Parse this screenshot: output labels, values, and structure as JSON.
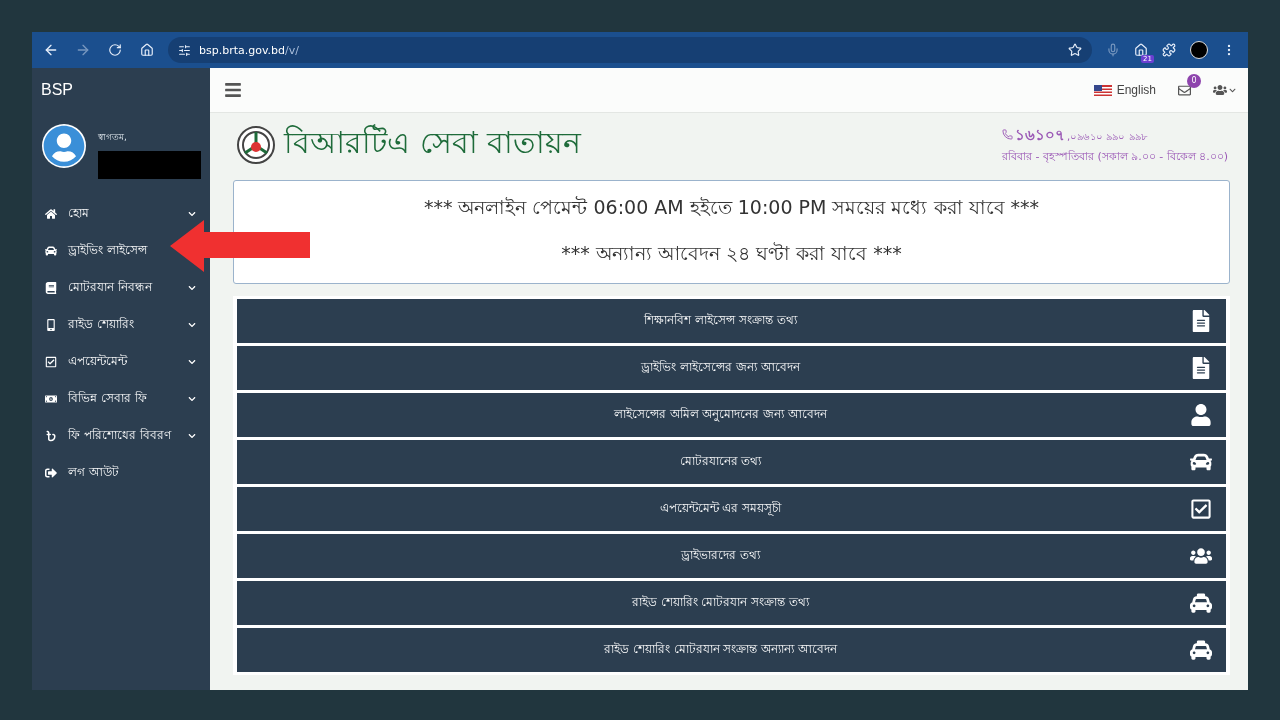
{
  "browser": {
    "url_host": "bsp.brta.gov.bd",
    "url_path": "/v/",
    "extension_badge": "21"
  },
  "sidebar": {
    "brand": "BSP",
    "greeting": "স্বাগতম,",
    "items": [
      {
        "label": "হোম",
        "kind": "home",
        "expandable": true
      },
      {
        "label": "ড্রাইভিং লাইসেন্স",
        "kind": "car",
        "expandable": false
      },
      {
        "label": "মোটরযান নিবন্ধন",
        "kind": "book",
        "expandable": true
      },
      {
        "label": "রাইড শেয়ারিং",
        "kind": "mobile",
        "expandable": true
      },
      {
        "label": "এপয়েন্টমেন্ট",
        "kind": "check",
        "expandable": true
      },
      {
        "label": "বিভিন্ন সেবার ফি",
        "kind": "money",
        "expandable": true
      },
      {
        "label": "ফি পরিশোধের বিবরণ",
        "kind": "taka",
        "expandable": true
      },
      {
        "label": "লগ আউট",
        "kind": "logout",
        "expandable": false
      }
    ]
  },
  "topbar": {
    "language": "English",
    "mail_count": "0"
  },
  "header": {
    "title": "বিআরটিএ সেবা বাতায়ন",
    "hotline": "১৬১০৭",
    "phones": ",০৯৬১০ ৯৯০ ৯৯৮",
    "hours": "রবিবার - বৃহস্পতিবার (সকাল ৯.০০ - বিকেল ৪.০০)"
  },
  "notice": [
    "*** অনলাইন পেমেন্ট 06:00 AM হইতে 10:00 PM সময়ের মধ্যে করা যাবে ***",
    "*** অন্যান্য আবেদন ২৪ ঘণ্টা করা যাবে ***"
  ],
  "services": [
    {
      "label": "শিক্ষানবিশ লাইসেন্স সংক্রান্ত তথ্য",
      "kind": "file"
    },
    {
      "label": "ড্রাইভিং লাইসেন্সের জন্য আবেদন",
      "kind": "file"
    },
    {
      "label": "লাইসেন্সের অমিল অনুমোদনের জন্য আবেদন",
      "kind": "user"
    },
    {
      "label": "মোটরযানের তথ্য",
      "kind": "car"
    },
    {
      "label": "এপয়েন্টমেন্ট এর সময়সূচী",
      "kind": "check"
    },
    {
      "label": "ড্রাইভারদের তথ্য",
      "kind": "users"
    },
    {
      "label": "রাইড শেয়ারিং মোটরযান সংক্রান্ত তথ্য",
      "kind": "taxi"
    },
    {
      "label": "রাইড শেয়ারিং মোটরযান সংক্রান্ত অন্যান্য আবেদন",
      "kind": "taxi"
    }
  ]
}
